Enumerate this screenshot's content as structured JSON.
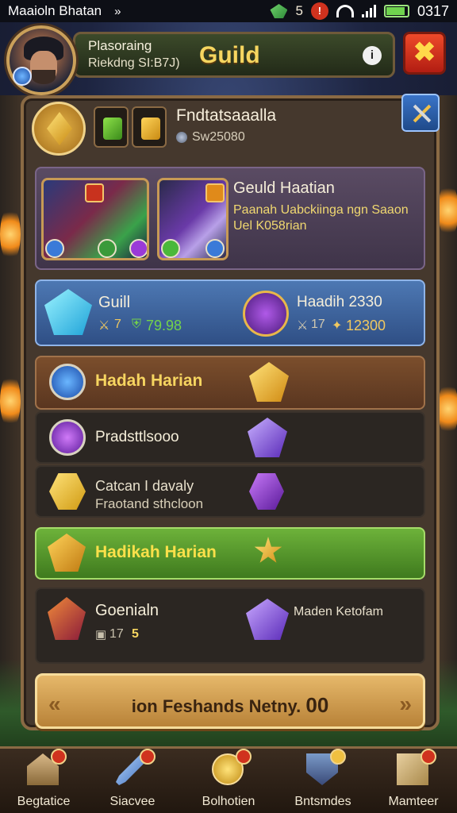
{
  "status_bar": {
    "carrier": "Maaioln Bhatan",
    "forward_glyph": "»",
    "gem_count": "5",
    "clock": "0317",
    "battery_level": 0.9
  },
  "header": {
    "player_line1": "Plasoraing",
    "player_line2": "Riekdng SI:B7J)",
    "title": "Guild",
    "info_label": "i",
    "close_label": "✖"
  },
  "guild": {
    "name": "Fndtatsaaalla",
    "sub": "Sw25080"
  },
  "featured": {
    "title": "Geuld Haatian",
    "line1": "Paanah Uabckiinga ngn Saaon",
    "line2": "Uel K058rian"
  },
  "stats": {
    "left_label": "Guill",
    "left_count": "7",
    "left_value": "79.98",
    "right_label": "Haadih 2330",
    "right_count": "17",
    "right_value": "12300"
  },
  "rows": {
    "brown_label": "Hadah Harian",
    "dark1_label": "Pradsttlsooo",
    "dark2_line1": "Catcan I davaly",
    "dark2_line2": "Fraotand sthcloon",
    "green_label": "Hadikah Harian",
    "dark3_label": "Goenialn",
    "dark3_count": "17",
    "dark3_value": "5",
    "dark3_right": "Maden Ketofam"
  },
  "bottom_button": {
    "label": "ion Feshands Netny.",
    "value": "00"
  },
  "nav": [
    {
      "label": "Begtatice"
    },
    {
      "label": "Siacvee"
    },
    {
      "label": "Bolhotien"
    },
    {
      "label": "Bntsmdes"
    },
    {
      "label": "Mamteer"
    }
  ],
  "colors": {
    "title_gold": "#f6d660",
    "close_red": "#d0321e",
    "panel_brown": "#45382d",
    "row_blue": "#3d63a0",
    "row_green": "#5ea030",
    "accent_green": "#74d34a"
  }
}
